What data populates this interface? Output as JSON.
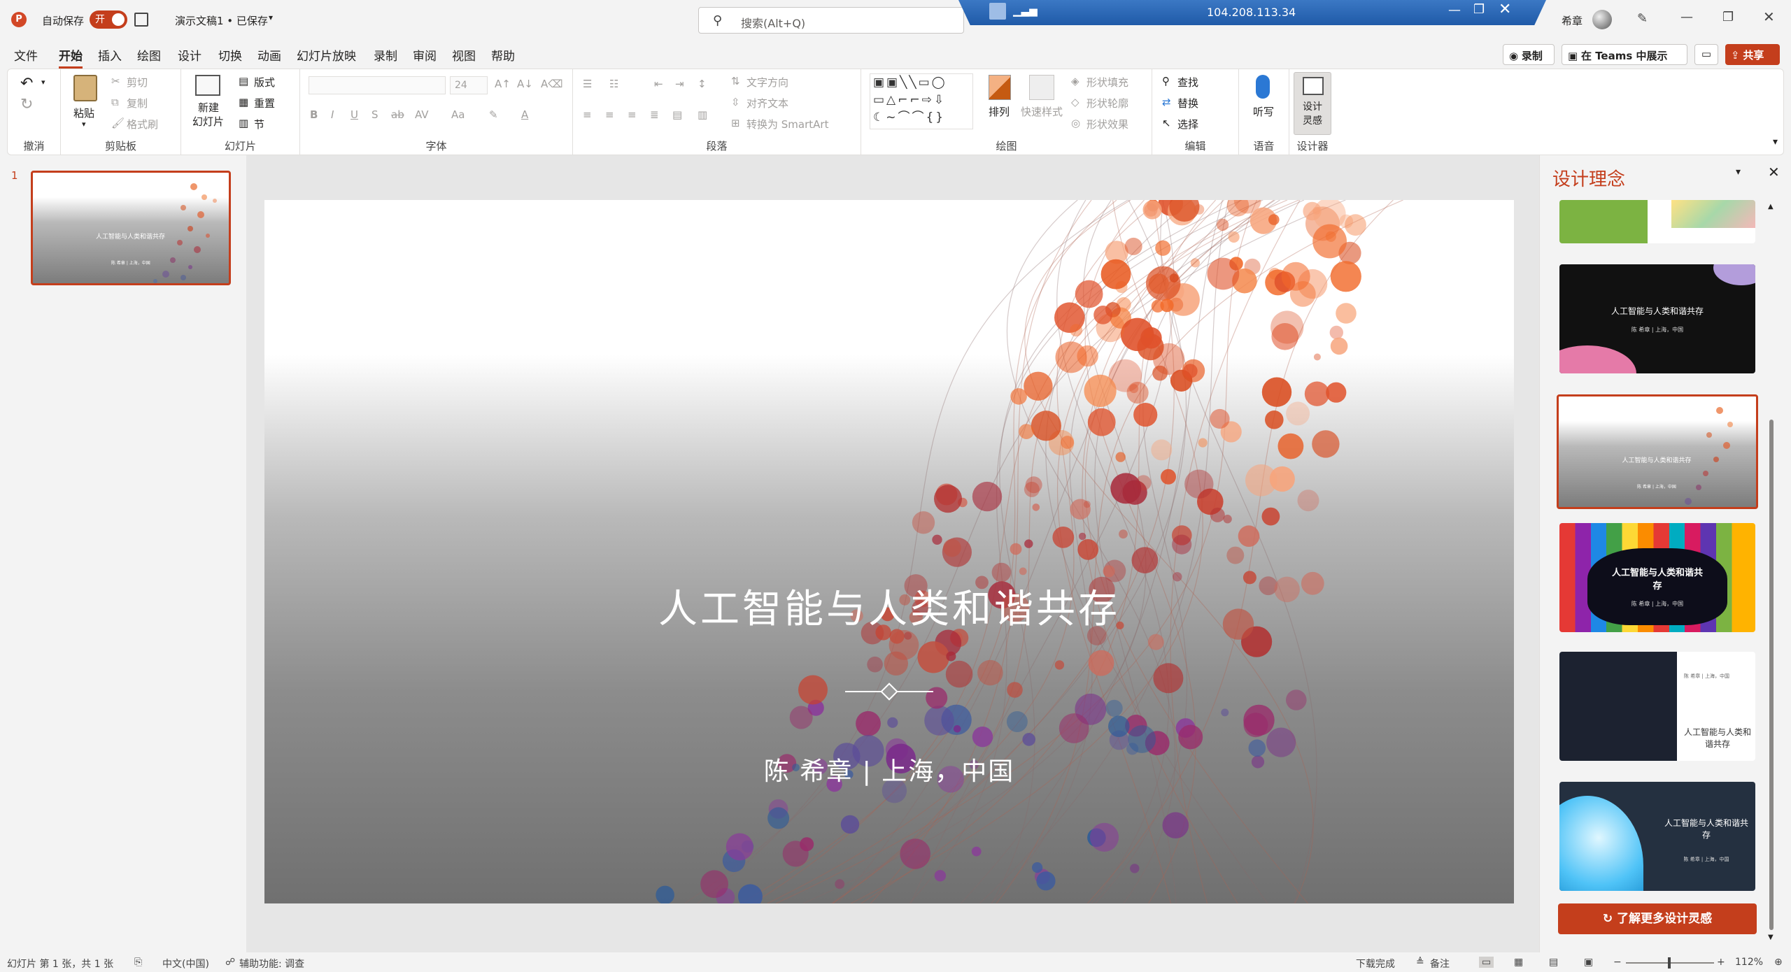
{
  "titlebar": {
    "autosave_label": "自动保存",
    "autosave_state": "开",
    "doc_title": "演示文稿1 • 已保存",
    "search_placeholder": "搜索(Alt+Q)",
    "user_name": "希章",
    "rdp_ip": "104.208.113.34"
  },
  "menu": {
    "tabs": [
      "文件",
      "开始",
      "插入",
      "绘图",
      "设计",
      "切换",
      "动画",
      "幻灯片放映",
      "录制",
      "审阅",
      "视图",
      "帮助"
    ],
    "active": "开始",
    "record_btn": "录制",
    "teams_btn": "在 Teams 中展示",
    "share_btn": "共享"
  },
  "ribbon": {
    "undo_group": "撤消",
    "clipboard": {
      "label": "剪贴板",
      "paste": "粘贴",
      "cut": "剪切",
      "copy": "复制",
      "format_painter": "格式刷"
    },
    "slides": {
      "label": "幻灯片",
      "new_slide_line1": "新建",
      "new_slide_line2": "幻灯片",
      "layout": "版式",
      "reset": "重置",
      "section": "节"
    },
    "font": {
      "label": "字体",
      "size": "24",
      "case": "Aa"
    },
    "paragraph": {
      "label": "段落",
      "text_direction": "文字方向",
      "align_text": "对齐文本",
      "smartart": "转换为 SmartArt"
    },
    "drawing": {
      "label": "绘图",
      "arrange": "排列",
      "quick_styles": "快速样式",
      "shape_fill": "形状填充",
      "shape_outline": "形状轮廓",
      "shape_effects": "形状效果"
    },
    "editing": {
      "label": "编辑",
      "find": "查找",
      "replace": "替换",
      "select": "选择"
    },
    "voice": {
      "label": "语音",
      "dictate": "听写"
    },
    "designer": {
      "label": "设计器",
      "ideas_line1": "设计",
      "ideas_line2": "灵感"
    }
  },
  "thumbnails": {
    "slide_number": "1",
    "thumb_title": "人工智能与人类和谐共存"
  },
  "slide": {
    "title": "人工智能与人类和谐共存",
    "subtitle": "陈 希章 | 上海，中国"
  },
  "design_pane": {
    "title": "设计理念",
    "cards": [
      {
        "title": "人工智能与人类和谐共存",
        "sub": "陈 希章 | 上海，中国"
      },
      {
        "title": "人工智能与人类和谐共存",
        "sub": "陈 希章 | 上海，中国"
      },
      {
        "title": "人工智能与人类和谐共存",
        "sub": "陈 希章 | 上海，中国"
      },
      {
        "title": "人工智能与人类和谐共存",
        "sub": "陈 希章 | 上海，中国"
      },
      {
        "title": "人工智能与人类和谐共存",
        "sub": "陈 希章 | 上海，中国"
      }
    ],
    "more_button": "了解更多设计灵感"
  },
  "status": {
    "slide_info": "幻灯片 第 1 张，共 1 张",
    "language": "中文(中国)",
    "accessibility": "辅助功能: 调查",
    "download": "下载完成",
    "notes": "备注",
    "zoom": "112%"
  },
  "colors": {
    "accent": "#c43e1c",
    "ppt_red": "#d24726"
  }
}
